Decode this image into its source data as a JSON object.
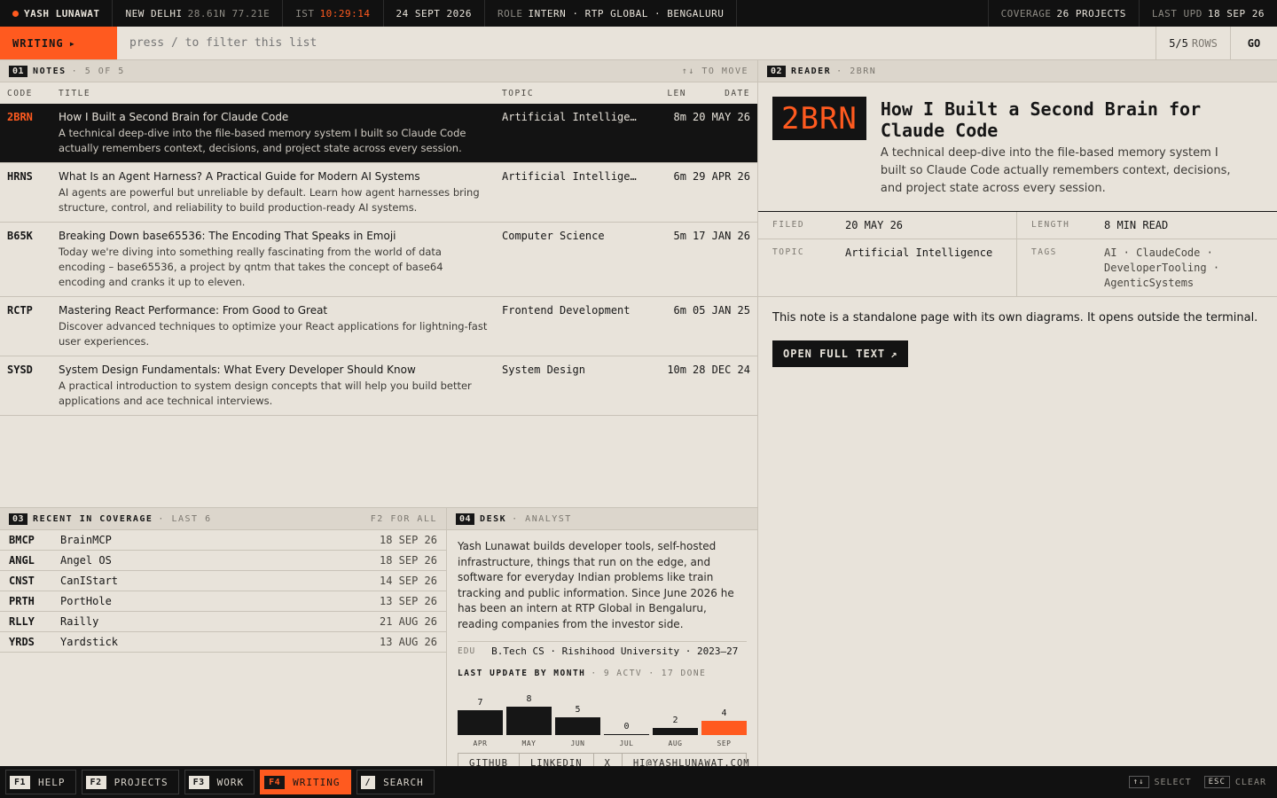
{
  "topbar": {
    "name": "YASH LUNAWAT",
    "city": "NEW DELHI",
    "coords": "28.61N 77.21E",
    "tz_label": "IST",
    "time": "10:29:14",
    "date": "24 SEPT 2026",
    "role_label": "ROLE",
    "role_value": "INTERN · RTP GLOBAL · BENGALURU",
    "coverage_label": "COVERAGE",
    "coverage_value": "26 PROJECTS",
    "lastupd_label": "LAST UPD",
    "lastupd_value": "18 SEP 26"
  },
  "filterbar": {
    "section": "WRITING",
    "section_arrow": "▸",
    "placeholder": "press / to filter this list",
    "rows_count": "5/5",
    "rows_label": "ROWS",
    "go": "GO"
  },
  "notes": {
    "badge": "01",
    "title": "NOTES",
    "subtitle": "· 5 OF 5",
    "hint": "↑↓ TO MOVE",
    "columns": {
      "code": "CODE",
      "title": "TITLE",
      "topic": "TOPIC",
      "len": "LEN",
      "date": "DATE"
    },
    "rows": [
      {
        "code": "2BRN",
        "title": "How I Built a Second Brain for Claude Code",
        "desc": "A technical deep-dive into the file-based memory system I built so Claude Code actually remembers context, decisions, and project state across every session.",
        "topic": "Artificial Intellige…",
        "len": "8m",
        "date": "20 MAY 26"
      },
      {
        "code": "HRNS",
        "title": "What Is an Agent Harness? A Practical Guide for Modern AI Systems",
        "desc": "AI agents are powerful but unreliable by default. Learn how agent harnesses bring structure, control, and reliability to build production-ready AI systems.",
        "topic": "Artificial Intellige…",
        "len": "6m",
        "date": "29 APR 26"
      },
      {
        "code": "B65K",
        "title": "Breaking Down base65536: The Encoding That Speaks in Emoji",
        "desc": "Today we're diving into something really fascinating from the world of data encoding – base65536, a project by qntm that takes the concept of base64 encoding and cranks it up to eleven.",
        "topic": "Computer Science",
        "len": "5m",
        "date": "17 JAN 26"
      },
      {
        "code": "RCTP",
        "title": "Mastering React Performance: From Good to Great",
        "desc": "Discover advanced techniques to optimize your React applications for lightning-fast user experiences.",
        "topic": "Frontend Development",
        "len": "6m",
        "date": "05 JAN 25"
      },
      {
        "code": "SYSD",
        "title": "System Design Fundamentals: What Every Developer Should Know",
        "desc": "A practical introduction to system design concepts that will help you build better applications and ace technical interviews.",
        "topic": "System Design",
        "len": "10m",
        "date": "28 DEC 24"
      }
    ]
  },
  "reader": {
    "badge": "02",
    "title": "READER",
    "subtitle": "· 2BRN",
    "code": "2BRN",
    "heading": "How I Built a Second Brain for Claude Code",
    "desc": "A technical deep-dive into the file-based memory system I built so Claude Code actually remembers context, decisions, and project state across every session.",
    "filed_label": "FILED",
    "filed_value": "20 MAY 26",
    "length_label": "LENGTH",
    "length_value": "8 MIN READ",
    "topic_label": "TOPIC",
    "topic_value": "Artificial Intelligence",
    "tags_label": "TAGS",
    "tags_value": "AI · ClaudeCode · DeveloperTooling · AgenticSystems",
    "note": "This note is a standalone page with its own diagrams. It opens outside the terminal.",
    "open_label": "OPEN FULL TEXT",
    "open_arrow": "↗"
  },
  "coverage": {
    "badge": "03",
    "title": "RECENT IN COVERAGE",
    "subtitle": "· LAST 6",
    "hint": "F2 FOR ALL",
    "rows": [
      {
        "code": "BMCP",
        "name": "BrainMCP",
        "date": "18 SEP 26"
      },
      {
        "code": "ANGL",
        "name": "Angel OS",
        "date": "18 SEP 26"
      },
      {
        "code": "CNST",
        "name": "CanIStart",
        "date": "14 SEP 26"
      },
      {
        "code": "PRTH",
        "name": "PortHole",
        "date": "13 SEP 26"
      },
      {
        "code": "RLLY",
        "name": "Railly",
        "date": "21 AUG 26"
      },
      {
        "code": "YRDS",
        "name": "Yardstick",
        "date": "13 AUG 26"
      }
    ]
  },
  "desk": {
    "badge": "04",
    "title": "DESK",
    "subtitle": "· ANALYST",
    "bio": "Yash Lunawat builds developer tools, self-hosted infrastructure, things that run on the edge, and software for everyday Indian problems like train tracking and public information. Since June 2026 he has been an intern at RTP Global in Bengaluru, reading companies from the investor side.",
    "edu_label": "EDU",
    "edu_value": "B.Tech CS · Rishihood University · 2023–27",
    "chart_title": "LAST UPDATE BY MONTH",
    "chart_sub": "· 9 ACTV · 17 DONE",
    "links": [
      "GITHUB",
      "LINKEDIN",
      "X",
      "HI@YASHLUNAWAT.COM"
    ]
  },
  "chart_data": {
    "type": "bar",
    "categories": [
      "APR",
      "MAY",
      "JUN",
      "JUL",
      "AUG",
      "SEP"
    ],
    "values": [
      7,
      8,
      5,
      0,
      2,
      4
    ],
    "highlight_index": 5,
    "highlight_color": "#ff5a1f",
    "bar_color": "#161616",
    "title": "LAST UPDATE BY MONTH"
  },
  "bottombar": {
    "keys": [
      {
        "key": "F1",
        "label": "HELP",
        "active": false
      },
      {
        "key": "F2",
        "label": "PROJECTS",
        "active": false
      },
      {
        "key": "F3",
        "label": "WORK",
        "active": false
      },
      {
        "key": "F4",
        "label": "WRITING",
        "active": true
      },
      {
        "key": "/",
        "label": "SEARCH",
        "active": false
      }
    ],
    "hint_select_key": "↑↓",
    "hint_select": "SELECT",
    "hint_clear_key": "ESC",
    "hint_clear": "CLEAR"
  },
  "colors": {
    "accent": "#ff5a1f",
    "ink": "#161616",
    "paper": "#e8e3da"
  }
}
